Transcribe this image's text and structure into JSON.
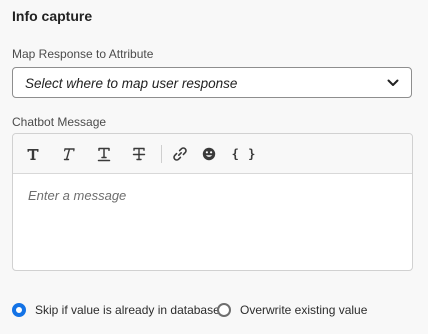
{
  "panel": {
    "title": "Info capture"
  },
  "map_response": {
    "label": "Map Response to Attribute",
    "selected_value": "Select where to map user response",
    "chevron_icon": "chevron-down-icon"
  },
  "chatbot_message": {
    "label": "Chatbot Message",
    "toolbar": {
      "bold_icon": "bold-icon",
      "italic_icon": "italic-icon",
      "underline_icon": "underline-icon",
      "strikethrough_icon": "strikethrough-icon",
      "link_icon": "link-icon",
      "emoji_icon": "emoji-icon",
      "variable_label": "{ }"
    },
    "placeholder": "Enter a message"
  },
  "options": {
    "selected": "skip",
    "skip_label": "Skip if value is already in database",
    "overwrite_label": "Overwrite existing value"
  },
  "colors": {
    "accent": "#1473e6",
    "background": "#f8f8f8"
  }
}
